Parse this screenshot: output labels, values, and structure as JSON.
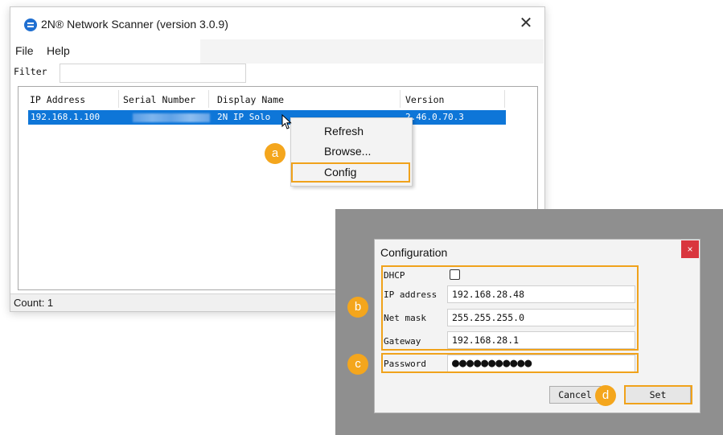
{
  "window": {
    "title": "2N® Network Scanner (version 3.0.9)",
    "close_glyph": "✕",
    "icon": "app-logo-icon"
  },
  "menu": {
    "file": "File",
    "help": "Help"
  },
  "filter": {
    "label": "Filter",
    "value": ""
  },
  "table": {
    "columns": [
      "IP Address",
      "Serial Number",
      "Display Name",
      "Version"
    ],
    "rows": [
      {
        "ip": "192.168.1.100",
        "serial": "",
        "display_name": "2N IP Solo",
        "version": "2.46.0.70.3"
      }
    ]
  },
  "status": {
    "text": "Count: 1"
  },
  "context_menu": {
    "items": [
      "Refresh",
      "Browse...",
      "Config"
    ]
  },
  "badges": {
    "a": "a",
    "b": "b",
    "c": "c",
    "d": "d"
  },
  "config": {
    "title": "Configuration",
    "close_glyph": "×",
    "dhcp_label": "DHCP",
    "dhcp_checked": false,
    "ip_label": "IP address",
    "ip_value": "192.168.28.48",
    "mask_label": "Net mask",
    "mask_value": "255.255.255.0",
    "gateway_label": "Gateway",
    "gateway_value": "192.168.28.1",
    "password_label": "Password",
    "password_value": "●●●●●●●●●●●",
    "cancel_label": "Cancel",
    "set_label": "Set"
  },
  "colors": {
    "accent_orange": "#f0a21b",
    "selection_blue": "#0e76d8",
    "close_red": "#d9363e",
    "panel_gray": "#8f8f8f"
  }
}
